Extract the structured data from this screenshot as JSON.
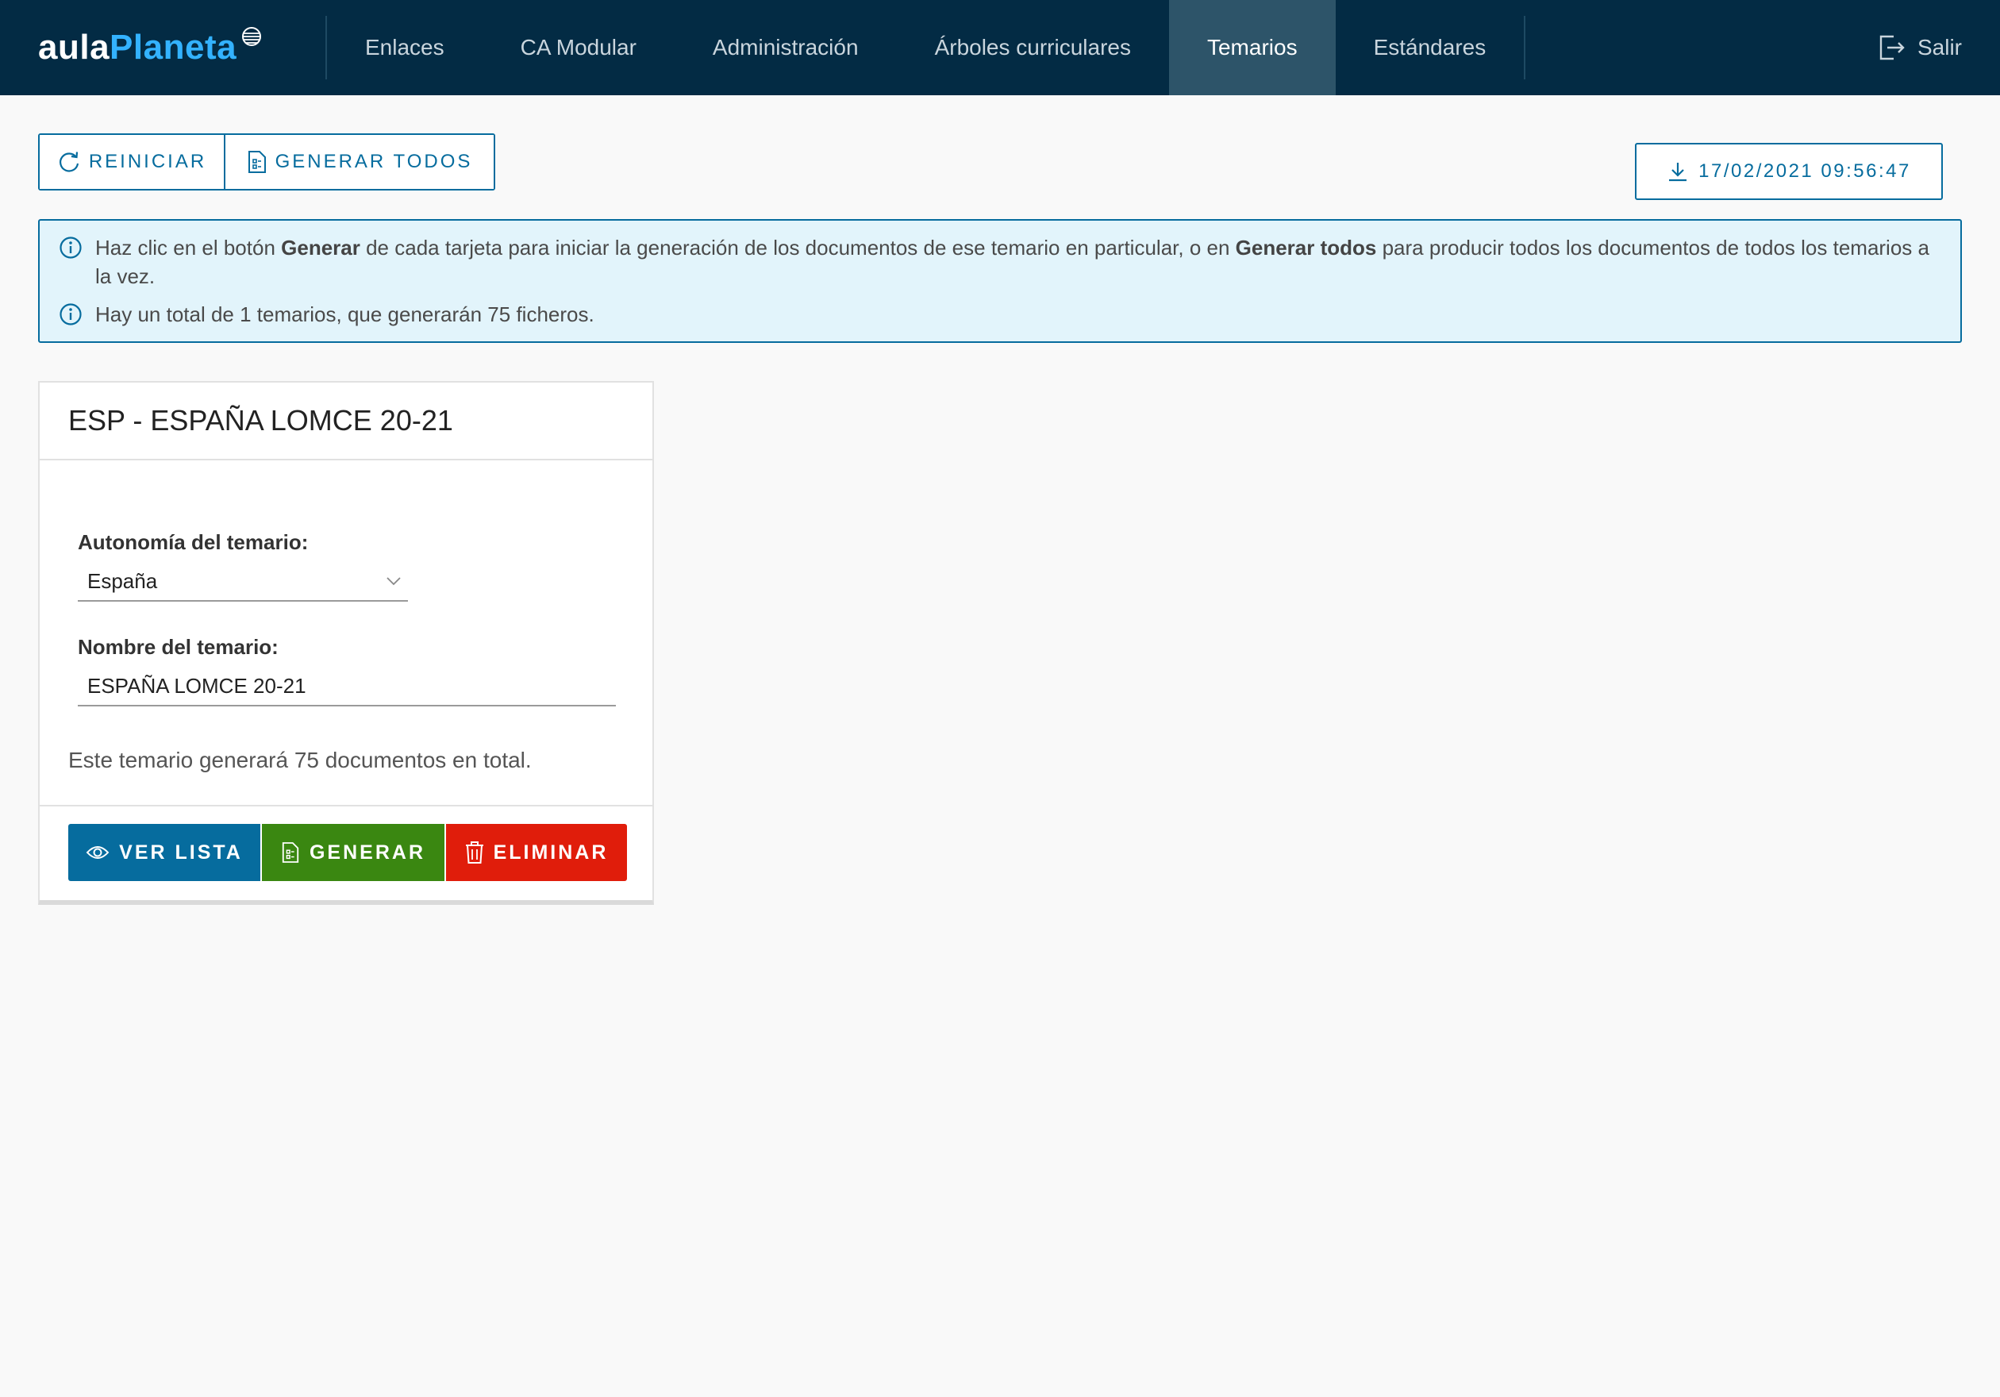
{
  "brand": {
    "part1": "aula",
    "part2": "Planeta"
  },
  "nav": {
    "items": [
      {
        "label": "Enlaces"
      },
      {
        "label": "CA Modular"
      },
      {
        "label": "Administración"
      },
      {
        "label": "Árboles curriculares"
      },
      {
        "label": "Temarios",
        "active": true
      },
      {
        "label": "Estándares"
      }
    ],
    "logout_label": "Salir"
  },
  "toolbar": {
    "reset_label": "REINICIAR",
    "generate_all_label": "GENERAR TODOS",
    "download_label": "17/02/2021 09:56:47"
  },
  "info": {
    "line1_prefix": "Haz clic en el botón ",
    "line1_bold1": "Generar",
    "line1_middle": " de cada tarjeta para iniciar la generación de los documentos de ese temario en particular, o en ",
    "line1_bold2": "Generar todos",
    "line1_suffix": " para producir todos los documentos de todos los temarios a la vez.",
    "line2": "Hay un total de 1 temarios, que generarán 75 ficheros."
  },
  "card": {
    "title": "ESP - ESPAÑA LOMCE 20-21",
    "autonomy_label": "Autonomía del temario:",
    "autonomy_value": "España",
    "name_label": "Nombre del temario:",
    "name_value": "ESPAÑA LOMCE 20-21",
    "note": "Este temario generará 75 documentos en total.",
    "view_label": "VER LISTA",
    "generate_label": "GENERAR",
    "delete_label": "ELIMINAR"
  },
  "colors": {
    "header_bg": "#032b44",
    "nav_active_bg": "#2d5469",
    "primary": "#066c9e",
    "info_bg": "#e2f4fb",
    "generate": "#3a8711",
    "delete": "#e01d0b"
  },
  "icons": {
    "reset": "refresh-icon",
    "generate_all": "document-icon",
    "download": "download-icon",
    "info": "info-icon",
    "view": "eye-icon",
    "generate": "document-icon",
    "delete": "trash-icon",
    "logout": "logout-icon",
    "dropdown": "chevron-down-icon"
  }
}
